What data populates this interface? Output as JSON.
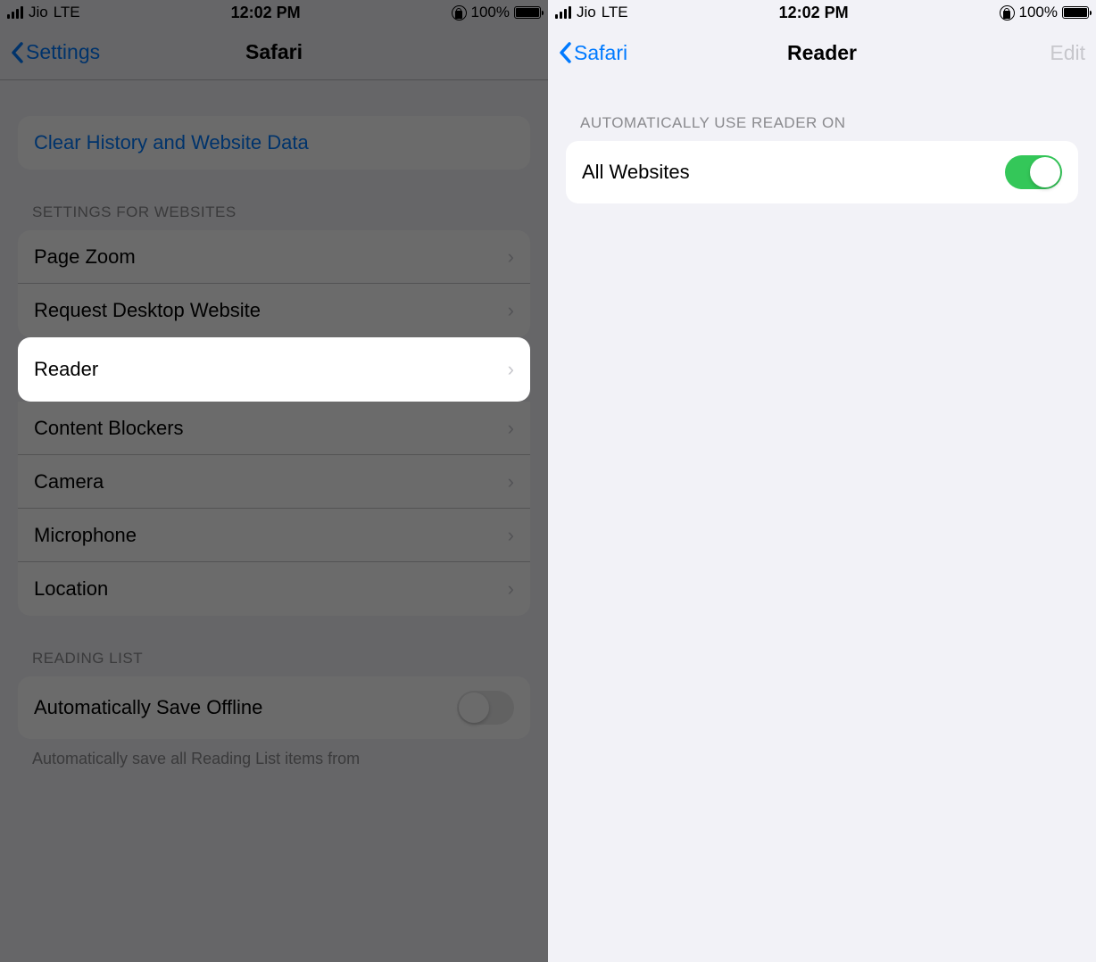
{
  "statusbar": {
    "carrier": "Jio",
    "network": "LTE",
    "time": "12:02 PM",
    "battery_pct": "100%"
  },
  "left": {
    "back_label": "Settings",
    "title": "Safari",
    "clear_history": "Clear History and Website Data",
    "settings_websites_header": "SETTINGS FOR WEBSITES",
    "items": {
      "page_zoom": "Page Zoom",
      "request_desktop": "Request Desktop Website",
      "reader": "Reader",
      "content_blockers": "Content Blockers",
      "camera": "Camera",
      "microphone": "Microphone",
      "location": "Location"
    },
    "reading_list_header": "READING LIST",
    "auto_save_offline": "Automatically Save Offline",
    "auto_save_footer": "Automatically save all Reading List items from"
  },
  "right": {
    "back_label": "Safari",
    "title": "Reader",
    "edit": "Edit",
    "section_header": "AUTOMATICALLY USE READER ON",
    "all_websites": "All Websites"
  }
}
